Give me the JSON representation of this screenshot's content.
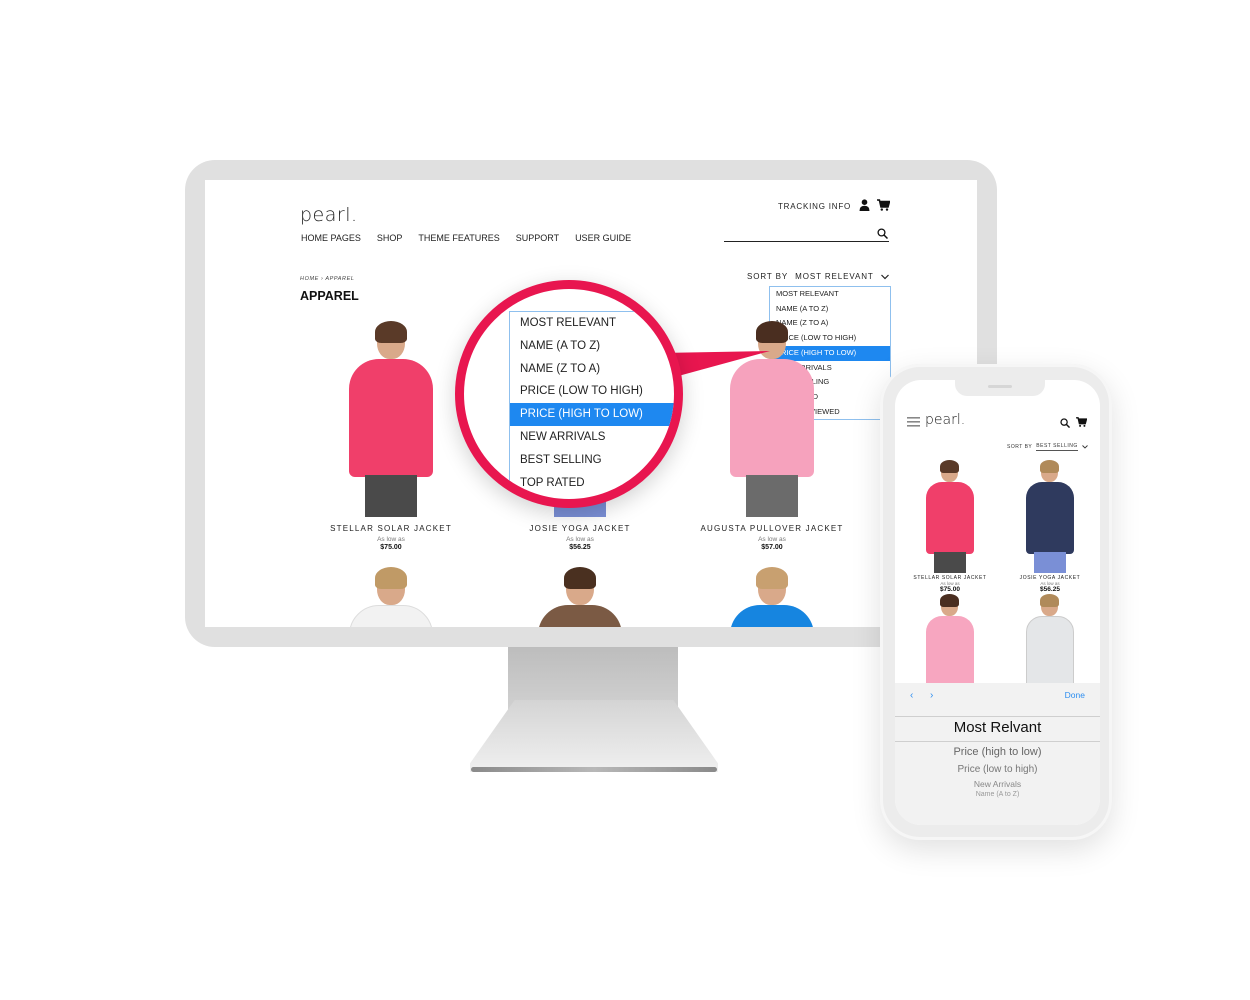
{
  "desktop": {
    "logo": "pearl.",
    "nav": [
      "HOME PAGES",
      "SHOP",
      "THEME FEATURES",
      "SUPPORT",
      "USER GUIDE"
    ],
    "tracking_info": "TRACKING INFO",
    "icons": {
      "user": "user-icon",
      "cart": "cart-icon",
      "search": "search-icon"
    },
    "breadcrumb": "HOME  ›  APPAREL",
    "page_title": "APPAREL",
    "sort": {
      "label": "SORT BY",
      "value": "MOST RELEVANT",
      "options": [
        "MOST RELEVANT",
        "NAME (A TO Z)",
        "NAME (Z TO A)",
        "PRICE (LOW TO HIGH)",
        "PRICE (HIGH TO LOW)",
        "NEW ARRIVALS",
        "BEST SELLING",
        "TOP RATED",
        "MOST REVIEWED"
      ],
      "highlighted": "PRICE (HIGH TO LOW)"
    },
    "products": [
      {
        "name": "STELLAR SOLAR JACKET",
        "as_low_as": "As low as",
        "price": "$75.00",
        "color": "#f03f6a",
        "hair": "#5a3a28"
      },
      {
        "name": "JOSIE YOGA JACKET",
        "as_low_as": "As low as",
        "price": "$56.25",
        "color": "#3a4b6e",
        "hair": "#8a6a44"
      },
      {
        "name": "AUGUSTA PULLOVER JACKET",
        "as_low_as": "As low as",
        "price": "$57.00",
        "color": "#f6a2bd",
        "hair": "#4a2e20"
      }
    ],
    "products_row2": [
      {
        "color": "#f2f2f2",
        "hair": "#c09a66"
      },
      {
        "color": "#7b5a44",
        "hair": "#4a3020"
      },
      {
        "color": "#1685e0",
        "hair": "#c8a070"
      }
    ]
  },
  "magnifier": {
    "options": [
      "MOST RELEVANT",
      "NAME (A TO Z)",
      "NAME (Z TO A)",
      "PRICE (LOW TO HIGH)",
      "PRICE (HIGH TO LOW)",
      "NEW ARRIVALS",
      "BEST SELLING",
      "TOP RATED"
    ],
    "highlighted_index": 4,
    "ring_color": "#e8164f"
  },
  "mobile": {
    "logo": "pearl.",
    "sort_label": "SORT BY",
    "sort_value": "BEST SELLING",
    "products": [
      {
        "name": "STELLAR SOLAR JACKET",
        "as_low_as": "As low as",
        "price": "$75.00",
        "color": "#f03f6a",
        "hair": "#5a3a28"
      },
      {
        "name": "JOSIE YOGA JACKET",
        "as_low_as": "As low as",
        "price": "$56.25",
        "color": "#2f3a5e",
        "hair": "#b08a5a"
      },
      {
        "color": "#f7a6c0",
        "hair": "#4a2e20"
      },
      {
        "color": "#e4e6e8",
        "hair": "#b08a5a"
      }
    ],
    "picker": {
      "prev": "‹",
      "next": "›",
      "done": "Done",
      "items": [
        "Most Relvant",
        "Price (high to low)",
        "Price (low to high)",
        "New Arrivals",
        "Name (A to Z)"
      ]
    }
  },
  "colors": {
    "accent_blue": "#1e88f0",
    "brand_red": "#e8164f",
    "ios_blue": "#2d8ef0"
  }
}
